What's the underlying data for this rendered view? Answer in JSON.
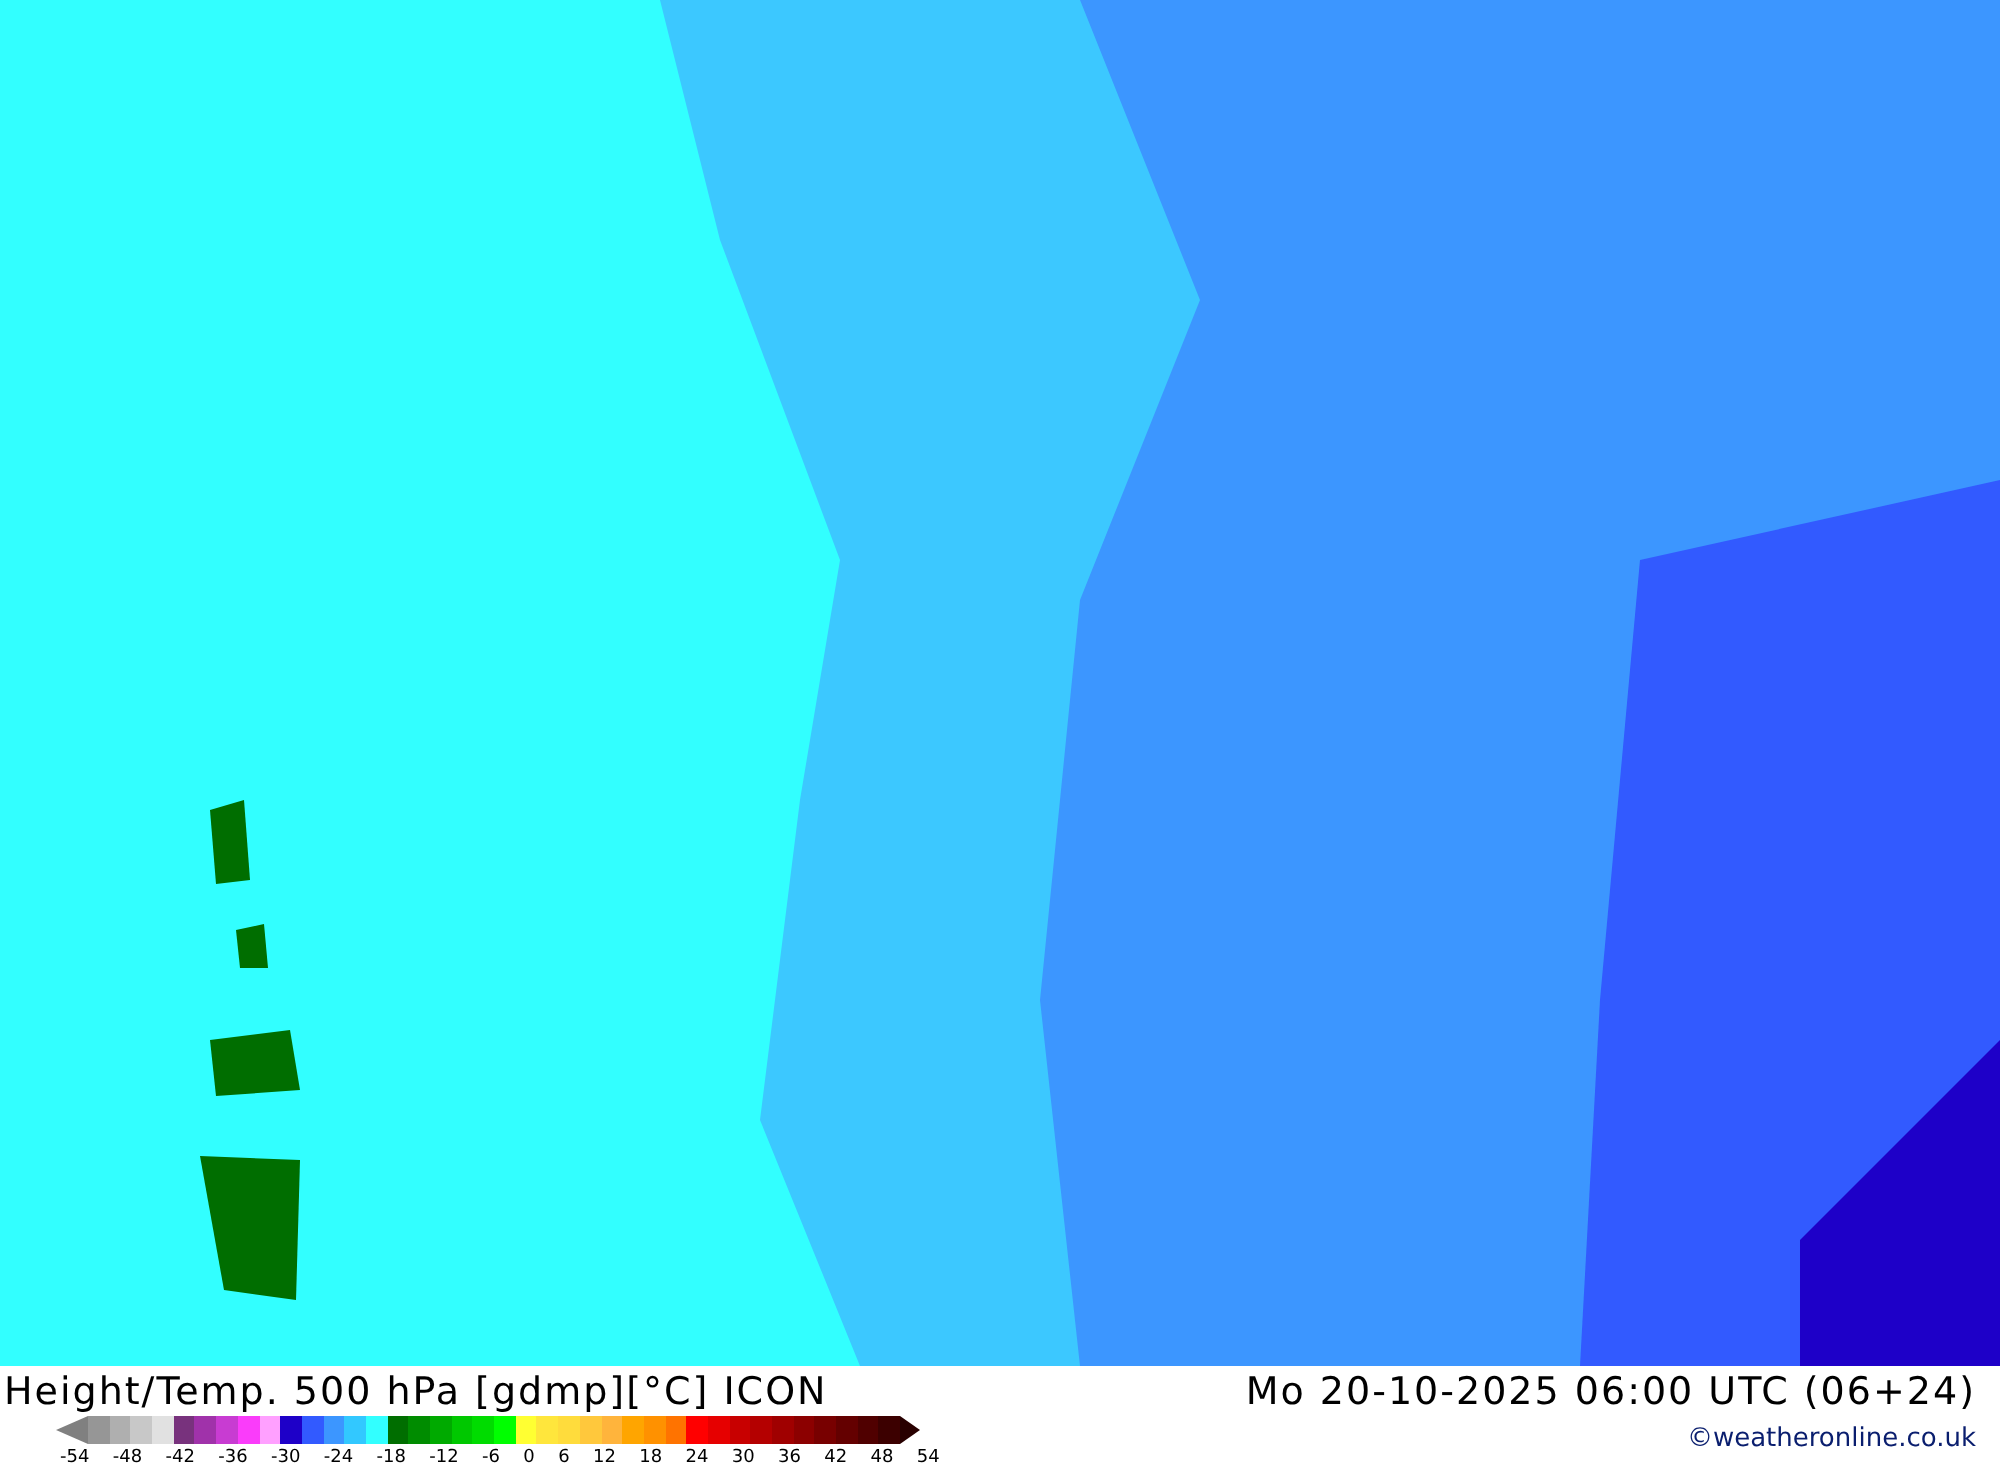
{
  "caption": {
    "title": "Height/Temp. 500 hPa [gdmp][°C] ICON",
    "datetime": "Mo 20-10-2025 06:00 UTC (06+24)",
    "copyright": "©weatheronline.co.uk"
  },
  "legend": {
    "swatches": [
      {
        "color": "#969696"
      },
      {
        "color": "#afafaf"
      },
      {
        "color": "#c8c8c8"
      },
      {
        "color": "#e1e1e1"
      },
      {
        "color": "#78327d"
      },
      {
        "color": "#a032aa"
      },
      {
        "color": "#c83cd2"
      },
      {
        "color": "#fa3cfa"
      },
      {
        "color": "#ffa0ff"
      },
      {
        "color": "#1e00c8"
      },
      {
        "color": "#325aff"
      },
      {
        "color": "#3c96ff"
      },
      {
        "color": "#32c8ff"
      },
      {
        "color": "#32ffff"
      },
      {
        "color": "#006e00"
      },
      {
        "color": "#008c00"
      },
      {
        "color": "#00aa00"
      },
      {
        "color": "#00c800"
      },
      {
        "color": "#00dc00"
      },
      {
        "color": "#00ff00"
      },
      {
        "color": "#ffff32"
      },
      {
        "color": "#ffe63c"
      },
      {
        "color": "#ffdc3c"
      },
      {
        "color": "#ffc83c"
      },
      {
        "color": "#ffb43c"
      },
      {
        "color": "#ffa500"
      },
      {
        "color": "#ff9100"
      },
      {
        "color": "#ff7300"
      },
      {
        "color": "#ff0000"
      },
      {
        "color": "#e60000"
      },
      {
        "color": "#c80000"
      },
      {
        "color": "#b40000"
      },
      {
        "color": "#a00000"
      },
      {
        "color": "#8c0000"
      },
      {
        "color": "#780000"
      },
      {
        "color": "#640000"
      },
      {
        "color": "#500000"
      },
      {
        "color": "#3c0000"
      }
    ],
    "ticks": [
      "-54",
      "-48",
      "-42",
      "-36",
      "-30",
      "-24",
      "-18",
      "-12",
      "-6",
      "0",
      "6",
      "12",
      "18",
      "24",
      "30",
      "36",
      "42",
      "48",
      "54"
    ]
  }
}
